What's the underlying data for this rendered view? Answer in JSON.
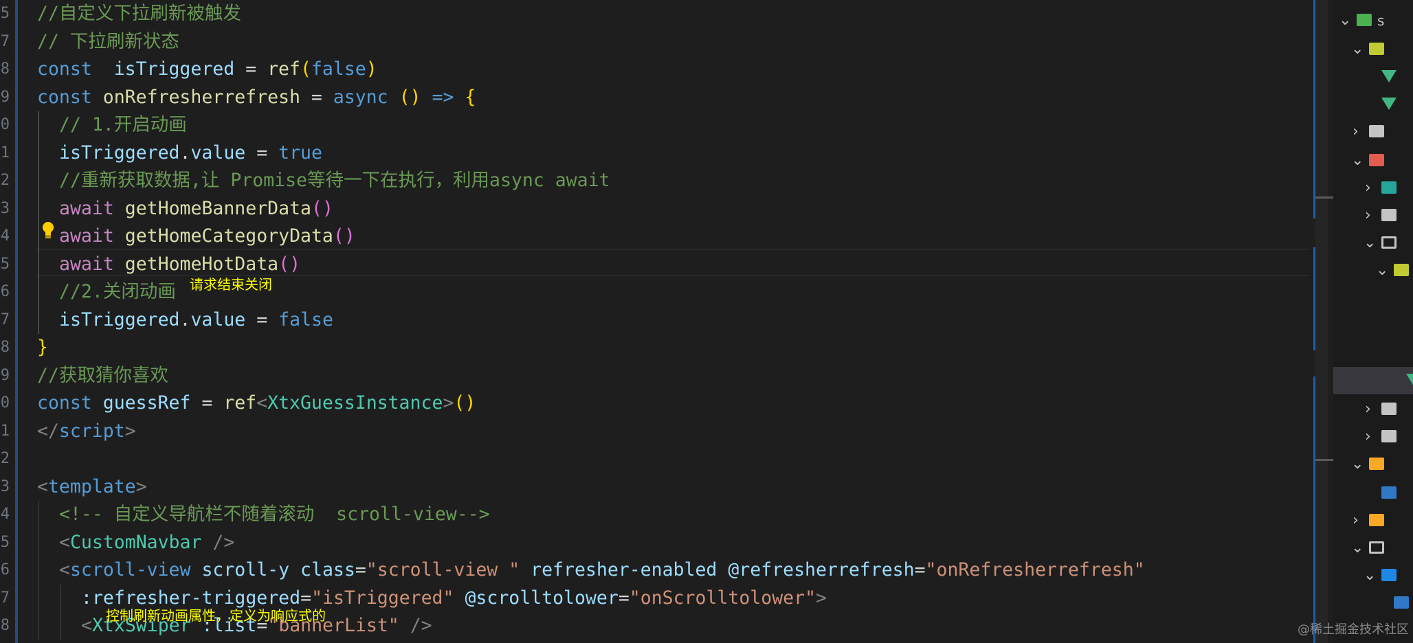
{
  "editor": {
    "gutter_numbers": [
      "5",
      "7",
      "8",
      "9",
      "0",
      "1",
      "2",
      "3",
      "4",
      "5",
      "6",
      "7",
      "8",
      "9",
      "0",
      "1",
      "2",
      "3",
      "4",
      "5",
      "6",
      "7",
      "8"
    ],
    "lines": [
      {
        "id": "l1",
        "indent": 0,
        "tokens": [
          [
            "c",
            "//自定义下拉刷新被触发"
          ]
        ]
      },
      {
        "id": "l2",
        "indent": 0,
        "tokens": [
          [
            "c",
            "// 下拉刷新状态"
          ]
        ]
      },
      {
        "id": "l3",
        "indent": 0,
        "tokens": [
          [
            "k",
            "const"
          ],
          [
            "",
            "  "
          ],
          [
            "v",
            "isTriggered"
          ],
          [
            "",
            " = "
          ],
          [
            "f",
            "ref"
          ],
          [
            "p1",
            "("
          ],
          [
            "k",
            "false"
          ],
          [
            "p1",
            ")"
          ]
        ]
      },
      {
        "id": "l4",
        "indent": 0,
        "tokens": [
          [
            "k",
            "const"
          ],
          [
            "",
            " "
          ],
          [
            "f",
            "onRefresherrefresh"
          ],
          [
            "",
            " = "
          ],
          [
            "k",
            "async"
          ],
          [
            "",
            " "
          ],
          [
            "p1",
            "()"
          ],
          [
            "",
            " "
          ],
          [
            "k",
            "=>"
          ],
          [
            "",
            " "
          ],
          [
            "p1",
            "{"
          ]
        ]
      },
      {
        "id": "l5",
        "indent": 1,
        "tokens": [
          [
            "c",
            "// 1.开启动画"
          ]
        ]
      },
      {
        "id": "l6",
        "indent": 1,
        "tokens": [
          [
            "v",
            "isTriggered"
          ],
          [
            "",
            "."
          ],
          [
            "v",
            "value"
          ],
          [
            "",
            " = "
          ],
          [
            "k",
            "true"
          ]
        ]
      },
      {
        "id": "l7",
        "indent": 1,
        "tokens": [
          [
            "c",
            "//重新获取数据,让 Promise等待一下在执行，利用async await"
          ]
        ]
      },
      {
        "id": "l8",
        "indent": 1,
        "tokens": [
          [
            "ctl",
            "await"
          ],
          [
            "",
            " "
          ],
          [
            "f",
            "getHomeBannerData"
          ],
          [
            "p2",
            "()"
          ]
        ]
      },
      {
        "id": "l9",
        "indent": 1,
        "tokens": [
          [
            "ctl",
            "await"
          ],
          [
            "",
            " "
          ],
          [
            "f",
            "getHomeCategoryData"
          ],
          [
            "p2",
            "()"
          ]
        ]
      },
      {
        "id": "l10",
        "indent": 1,
        "tokens": [
          [
            "ctl",
            "await"
          ],
          [
            "",
            " "
          ],
          [
            "f",
            "getHomeHotData"
          ],
          [
            "p2",
            "()"
          ]
        ]
      },
      {
        "id": "l11",
        "indent": 1,
        "tokens": [
          [
            "c",
            "//2.关闭动画"
          ]
        ]
      },
      {
        "id": "l12",
        "indent": 1,
        "tokens": [
          [
            "v",
            "isTriggered"
          ],
          [
            "",
            "."
          ],
          [
            "v",
            "value"
          ],
          [
            "",
            " = "
          ],
          [
            "k",
            "false"
          ]
        ]
      },
      {
        "id": "l13",
        "indent": 0,
        "tokens": [
          [
            "p1",
            "}"
          ]
        ]
      },
      {
        "id": "l14",
        "indent": 0,
        "tokens": [
          [
            "c",
            "//获取猜你喜欢"
          ]
        ]
      },
      {
        "id": "l15",
        "indent": 0,
        "tokens": [
          [
            "k",
            "const"
          ],
          [
            "",
            " "
          ],
          [
            "v",
            "guessRef"
          ],
          [
            "",
            " = "
          ],
          [
            "f",
            "ref"
          ],
          [
            "pun",
            "<"
          ],
          [
            "ty",
            "XtxGuessInstance"
          ],
          [
            "pun",
            ">"
          ],
          [
            "p1",
            "()"
          ]
        ]
      },
      {
        "id": "l16",
        "indent": 0,
        "tokens": [
          [
            "pun",
            "</"
          ],
          [
            "tg",
            "script"
          ],
          [
            "pun",
            ">"
          ]
        ]
      },
      {
        "id": "l17",
        "indent": 0,
        "tokens": []
      },
      {
        "id": "l18",
        "indent": 0,
        "tokens": [
          [
            "pun",
            "<"
          ],
          [
            "tg",
            "template"
          ],
          [
            "pun",
            ">"
          ]
        ]
      },
      {
        "id": "l19",
        "indent": 1,
        "tokens": [
          [
            "c",
            "<!-- 自定义导航栏不随着滚动  scroll-view-->"
          ]
        ]
      },
      {
        "id": "l20",
        "indent": 1,
        "tokens": [
          [
            "pun",
            "<"
          ],
          [
            "ty",
            "CustomNavbar"
          ],
          [
            "",
            " "
          ],
          [
            "pun",
            "/>"
          ]
        ]
      },
      {
        "id": "l21",
        "indent": 1,
        "tokens": [
          [
            "pun",
            "<"
          ],
          [
            "tg",
            "scroll-view"
          ],
          [
            "",
            " "
          ],
          [
            "at",
            "scroll-y"
          ],
          [
            "",
            " "
          ],
          [
            "at",
            "class"
          ],
          [
            "",
            "="
          ],
          [
            "s",
            "\"scroll-view \""
          ],
          [
            "",
            " "
          ],
          [
            "at",
            "refresher-enabled"
          ],
          [
            "",
            " "
          ],
          [
            "at",
            "@refresherrefresh"
          ],
          [
            "",
            "="
          ],
          [
            "s",
            "\"onRefresherrefresh\""
          ]
        ]
      },
      {
        "id": "l22",
        "indent": 2,
        "tokens": [
          [
            "at",
            ":refresher-triggered"
          ],
          [
            "",
            "="
          ],
          [
            "s",
            "\"isTriggered\""
          ],
          [
            "",
            " "
          ],
          [
            "at",
            "@scrolltolower"
          ],
          [
            "",
            "="
          ],
          [
            "s",
            "\"onScrolltolower\""
          ],
          [
            "pun",
            ">"
          ]
        ]
      },
      {
        "id": "l23",
        "indent": 2,
        "tokens": [
          [
            "pun",
            "<"
          ],
          [
            "ty",
            "XtxSwiper"
          ],
          [
            "",
            " "
          ],
          [
            "at",
            ":list"
          ],
          [
            "",
            "="
          ],
          [
            "s",
            "\"bannerList\""
          ],
          [
            "",
            " "
          ],
          [
            "pun",
            "/>"
          ]
        ]
      }
    ]
  },
  "annotations": {
    "close_animation_note": "请求结束关闭",
    "triggered_attr_note": "控制刷新动画属性，定义为响应式的"
  },
  "watermark": "@稀土掘金技术社区",
  "explorer": {
    "sidebar_label_fragment": "s"
  },
  "colors": {
    "background": "#1e1e1e",
    "comment": "#6a9955",
    "keyword": "#569cd6",
    "variable": "#9cdcfe",
    "function": "#dcdcaa",
    "control": "#c586c0",
    "string": "#ce9178",
    "type": "#4ec9b0",
    "annotation": "#ffff00"
  }
}
